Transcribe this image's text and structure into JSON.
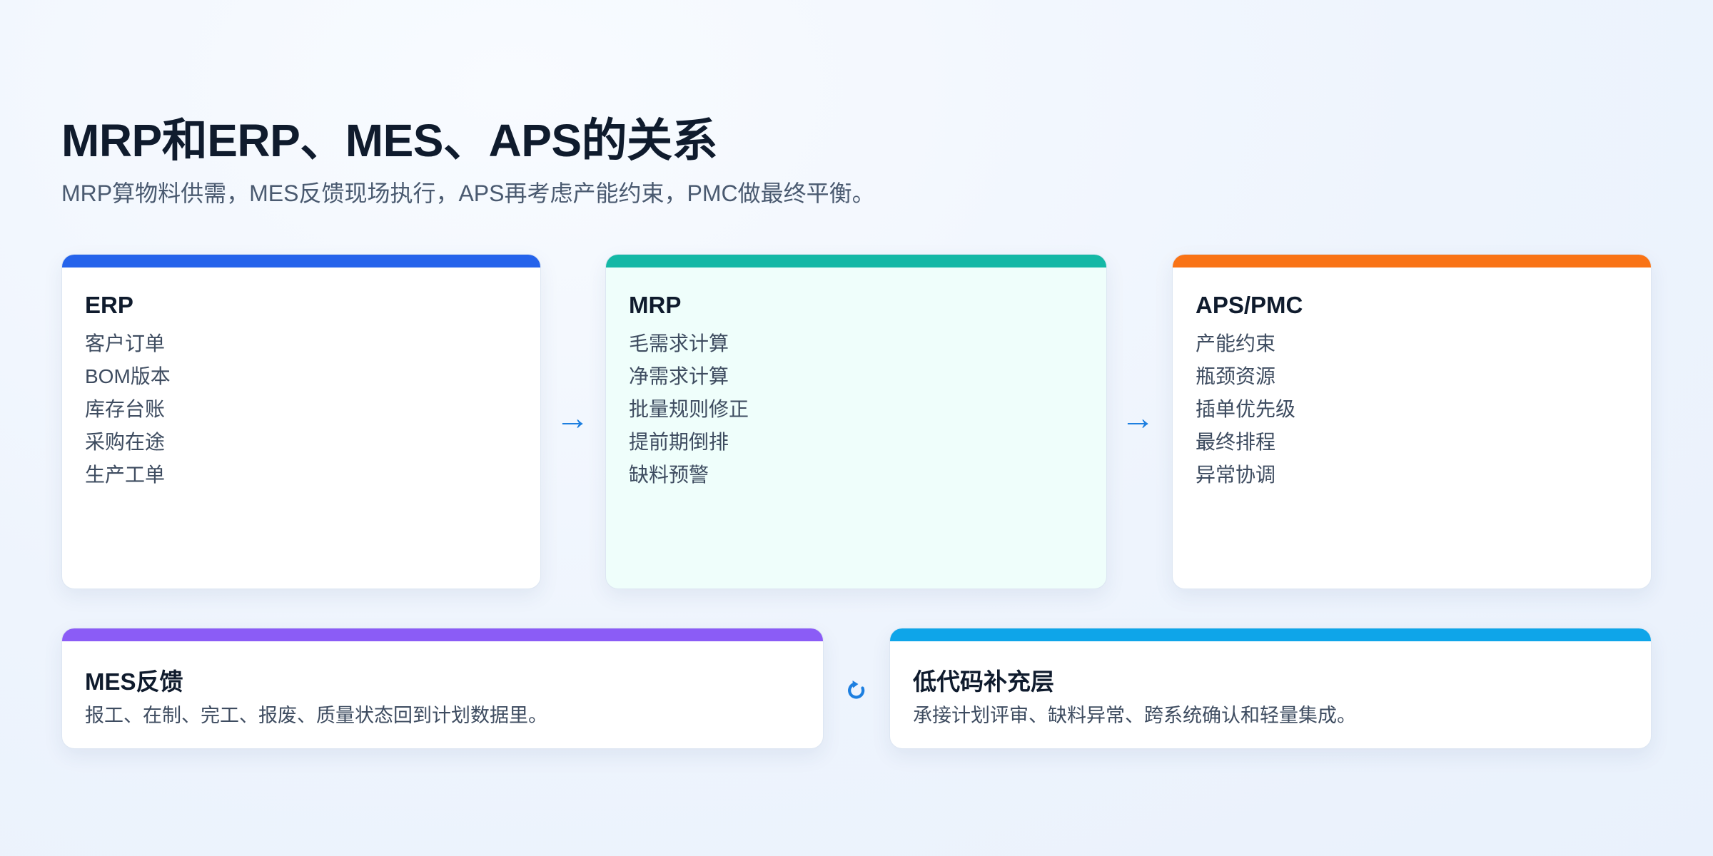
{
  "title": "MRP和ERP、MES、APS的关系",
  "subtitle": "MRP算物料供需，MES反馈现场执行，APS再考虑产能约束，PMC做最终平衡。",
  "colors": {
    "erp": "#2563eb",
    "mrp": "#14b8a6",
    "aps": "#f97316",
    "mes": "#8b5cf6",
    "lowcode": "#0ea5e9",
    "arrow": "#1d7fe0"
  },
  "cards": {
    "erp": {
      "title": "ERP",
      "items": [
        "客户订单",
        "BOM版本",
        "库存台账",
        "采购在途",
        "生产工单"
      ]
    },
    "mrp": {
      "title": "MRP",
      "items": [
        "毛需求计算",
        "净需求计算",
        "批量规则修正",
        "提前期倒排",
        "缺料预警"
      ]
    },
    "aps": {
      "title": "APS/PMC",
      "items": [
        "产能约束",
        "瓶颈资源",
        "插单优先级",
        "最终排程",
        "异常协调"
      ]
    },
    "mes": {
      "title": "MES反馈",
      "desc": "报工、在制、完工、报废、质量状态回到计划数据里。"
    },
    "lowcode": {
      "title": "低代码补充层",
      "desc": "承接计划评审、缺料异常、跨系统确认和轻量集成。"
    }
  },
  "arrows": {
    "erp_to_mrp": "→",
    "mrp_to_aps": "→"
  },
  "icons": {
    "cycle": "cycle-arrow-icon"
  }
}
